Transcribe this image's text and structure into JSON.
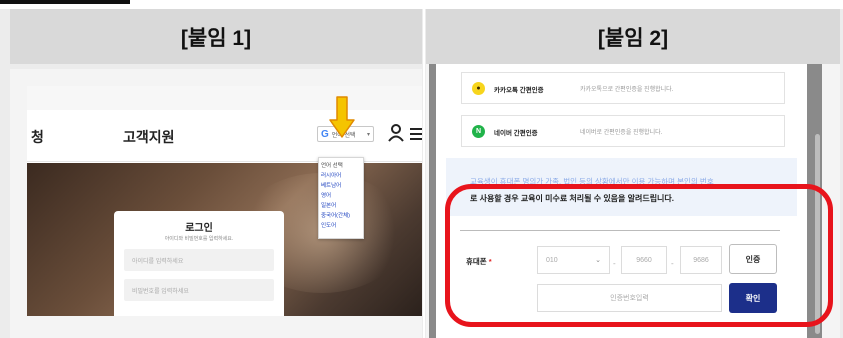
{
  "labels": {
    "left": "[붙임 1]",
    "right": "[붙임 2]"
  },
  "panel1": {
    "nav_left_text": "청",
    "nav_center_text": "고객지원",
    "language_button": "언어 선택",
    "language_menu": [
      "언어 선택",
      "러시아어",
      "베트남어",
      "영어",
      "일본어",
      "중국어(간체)",
      "인도어"
    ],
    "login": {
      "title": "로그인",
      "subtitle": "아이디와 비밀번호를 입력하세요.",
      "id_placeholder": "아이디를 입력하세요",
      "pw_placeholder": "비밀번호를 입력하세요"
    },
    "colors": {
      "arrow": "#f5c400",
      "arrow_outline": "#e08a00",
      "hero": "#6a4e3a"
    }
  },
  "panel2": {
    "auth_options": [
      {
        "icon": "kakao-icon",
        "name": "카카오톡 간편인증",
        "desc": "카카오톡으로 간편인증을 진행합니다.",
        "color": "#f7d51d"
      },
      {
        "icon": "naver-icon",
        "name": "네이버 간편인증",
        "desc": "네이버로 간편인증을 진행합니다.",
        "color": "#21b34a"
      }
    ],
    "notice_line1": "교육생이 휴대폰 명의가 가족, 법인 등의 상황에서만 이용 가능하며 본인의 번호",
    "notice_line2": "로 사용할 경우 교육이 미수료 처리될 수 있음을 알려드립니다.",
    "phone": {
      "label": "휴대폰",
      "required_mark": "*",
      "prefix": "010",
      "middle": "9660",
      "last": "9686",
      "code_placeholder": "인증번호입력"
    },
    "verify_button": "인증",
    "confirm_button": "확인",
    "colors": {
      "confirm": "#1c2f8a",
      "highlight": "#e8141c",
      "required": "#e02424"
    }
  }
}
